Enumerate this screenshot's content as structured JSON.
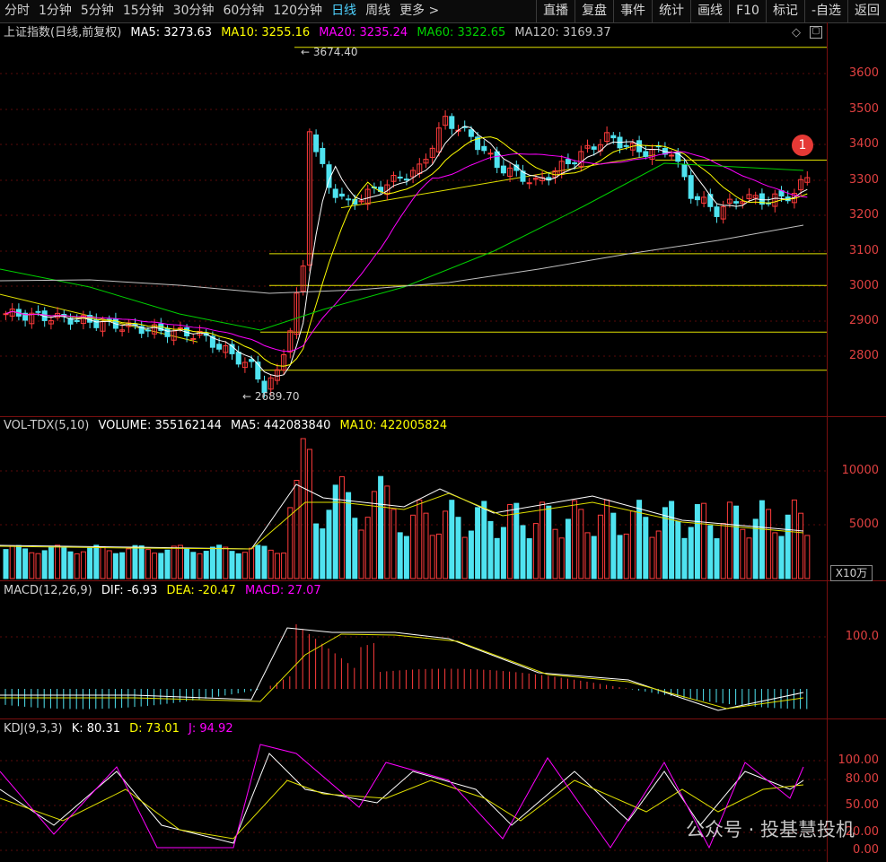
{
  "toolbar": {
    "periods": [
      "分时",
      "1分钟",
      "5分钟",
      "15分钟",
      "30分钟",
      "60分钟",
      "120分钟",
      "日线",
      "周线",
      "更多 >"
    ],
    "active_period": "日线",
    "buttons": [
      "直播",
      "复盘",
      "事件",
      "统计",
      "画线",
      "F10",
      "标记",
      "-自选",
      "返回"
    ]
  },
  "main_legend": {
    "title": "上证指数(日线,前复权)",
    "ma5": "MA5: 3273.63",
    "ma10": "MA10: 3255.16",
    "ma20": "MA20: 3235.24",
    "ma60": "MA60: 3322.65",
    "ma120": "MA120: 3169.37",
    "high_label": "3674.40",
    "low_label": "2689.70",
    "y_ticks": [
      "3600",
      "3500",
      "3400",
      "3300",
      "3200",
      "3100",
      "3000",
      "2900",
      "2800"
    ]
  },
  "volume_legend": {
    "title": "VOL-TDX(5,10)",
    "volume": "VOLUME: 355162144",
    "ma5": "MA5: 442083840",
    "ma10": "MA10: 422005824",
    "y_ticks": [
      "10000",
      "5000"
    ],
    "unit": "X10万"
  },
  "macd_legend": {
    "title": "MACD(12,26,9)",
    "dif": "DIF: -6.93",
    "dea": "DEA: -20.47",
    "macd": "MACD: 27.07",
    "y_ticks": [
      "100.0"
    ]
  },
  "kdj_legend": {
    "title": "KDJ(9,3,3)",
    "k": "K: 80.31",
    "d": "D: 73.01",
    "j": "J: 94.92",
    "y_ticks": [
      "100.00",
      "80.00",
      "50.00",
      "20.00",
      "0.00"
    ]
  },
  "badge": "1",
  "watermark": "公众号 · 投基慧投机",
  "colors": {
    "up": "#ff3b3b",
    "down": "#4fe3f0",
    "ma5": "#ffffff",
    "ma10": "#ffff00",
    "ma20": "#ff00ff",
    "ma60": "#00d000",
    "ma120": "#c0c0c0"
  }
}
